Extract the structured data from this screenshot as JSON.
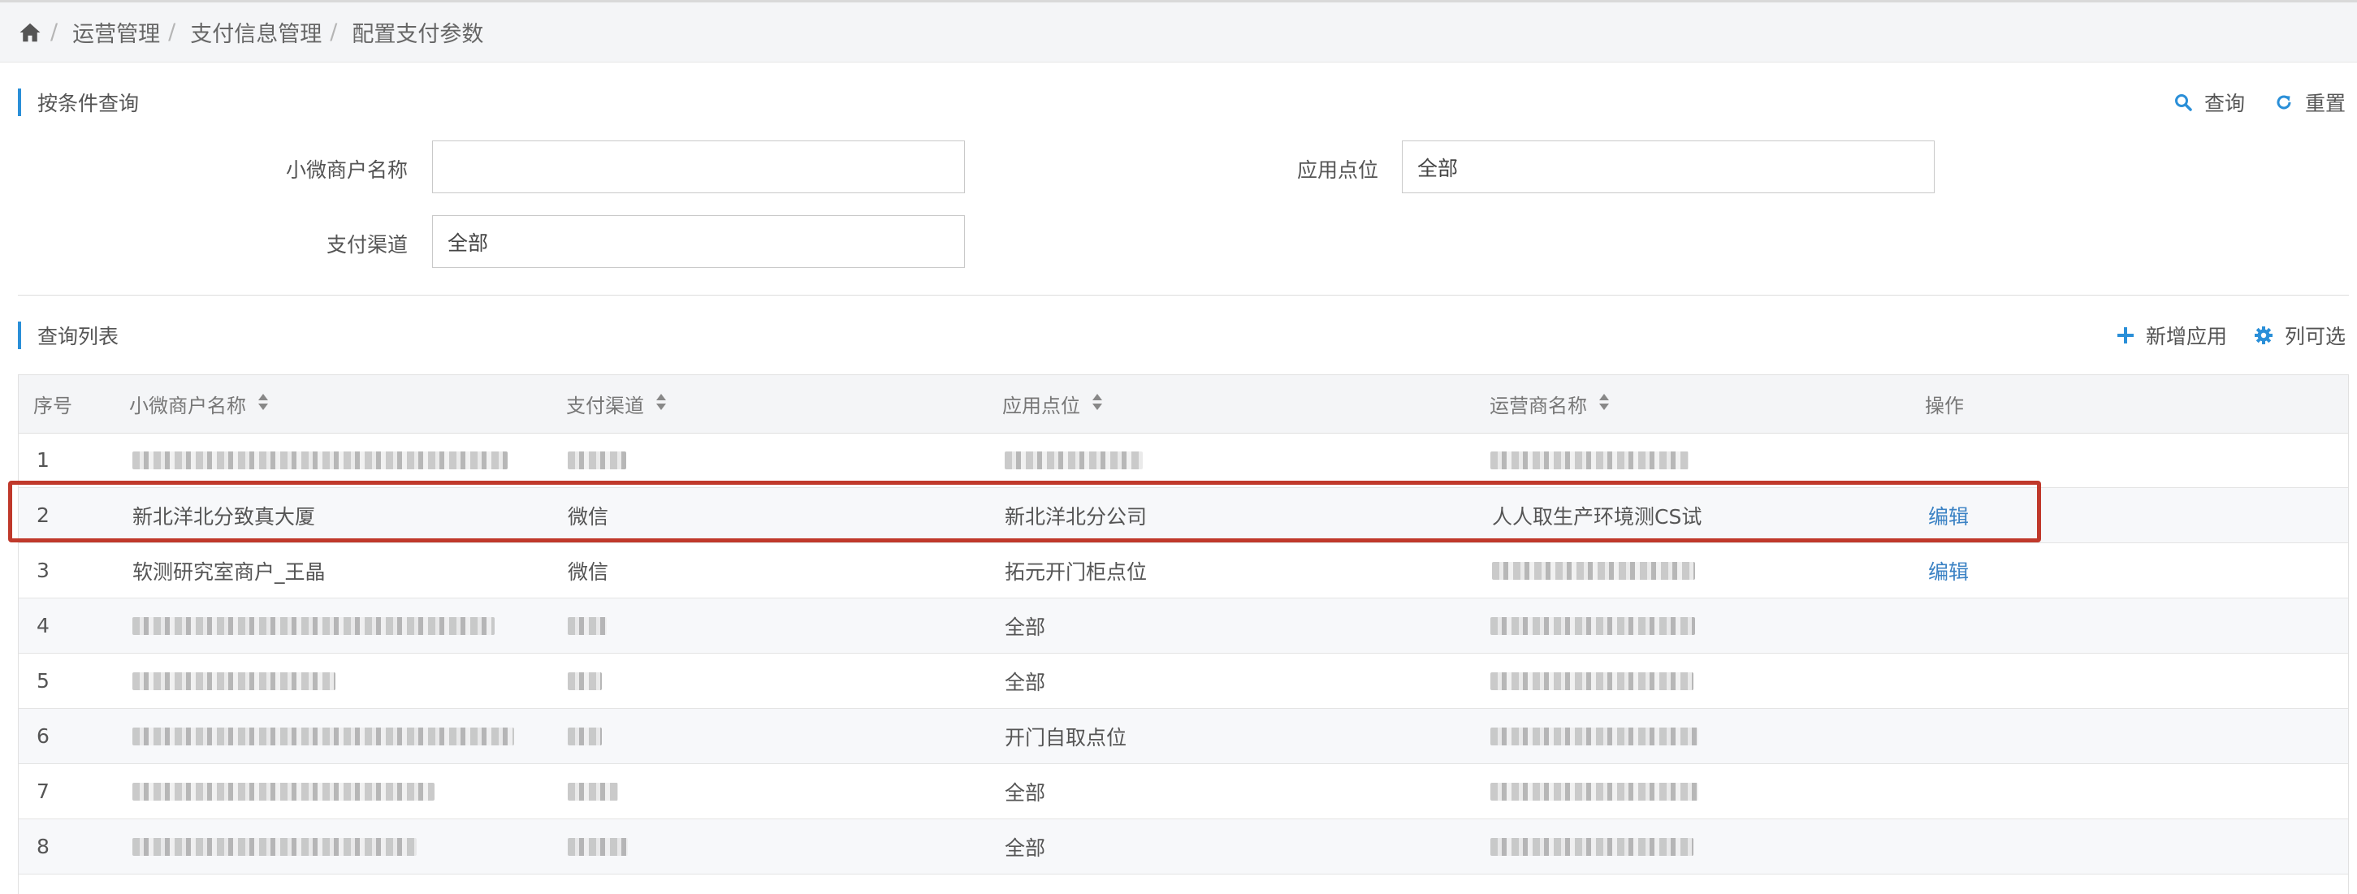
{
  "breadcrumb": {
    "items": [
      "运营管理",
      "支付信息管理",
      "配置支付参数"
    ],
    "separator": "/"
  },
  "query_section": {
    "title": "按条件查询",
    "search_label": "查询",
    "reset_label": "重置",
    "fields": {
      "merchant_name": {
        "label": "小微商户名称",
        "value": ""
      },
      "app_point": {
        "label": "应用点位",
        "value": "全部"
      },
      "pay_channel": {
        "label": "支付渠道",
        "value": "全部"
      }
    }
  },
  "list_section": {
    "title": "查询列表",
    "add_label": "新增应用",
    "columns_label": "列可选"
  },
  "table": {
    "headers": [
      "序号",
      "小微商户名称",
      "支付渠道",
      "应用点位",
      "运营商名称",
      "操作"
    ],
    "rows": [
      {
        "index": "1",
        "merchant": "",
        "channel": "",
        "point": "",
        "operator": "",
        "action": "",
        "blurred": [
          "merchant",
          "channel",
          "point",
          "operator"
        ]
      },
      {
        "index": "2",
        "merchant": "新北洋北分致真大厦",
        "channel": "微信",
        "point": "新北洋北分公司",
        "operator": "人人取生产环境测CS试",
        "action": "编辑",
        "blurred": []
      },
      {
        "index": "3",
        "merchant": "软测研究室商户_王晶",
        "channel": "微信",
        "point": "拓元开门柜点位",
        "operator": "",
        "action": "编辑",
        "blurred": [
          "operator"
        ]
      },
      {
        "index": "4",
        "merchant": "",
        "channel": "",
        "point": "全部",
        "operator": "",
        "action": "",
        "blurred": [
          "merchant",
          "channel",
          "operator"
        ]
      },
      {
        "index": "5",
        "merchant": "",
        "channel": "",
        "point": "全部",
        "operator": "",
        "action": "",
        "blurred": [
          "merchant",
          "channel",
          "operator"
        ]
      },
      {
        "index": "6",
        "merchant": "",
        "channel": "",
        "point": "开门自取点位",
        "operator": "",
        "action": "",
        "blurred": [
          "merchant",
          "channel",
          "operator"
        ]
      },
      {
        "index": "7",
        "merchant": "",
        "channel": "",
        "point": "全部",
        "operator": "",
        "action": "",
        "blurred": [
          "merchant",
          "channel",
          "operator"
        ]
      },
      {
        "index": "8",
        "merchant": "",
        "channel": "",
        "point": "全部",
        "operator": "",
        "action": "",
        "blurred": [
          "merchant",
          "channel",
          "operator"
        ]
      }
    ]
  },
  "colors": {
    "accent": "#2a8fd8",
    "link": "#3b82c4",
    "highlight_box": "#c0392b"
  },
  "icons": [
    "home-icon",
    "search-icon",
    "refresh-icon",
    "plus-icon",
    "gear-icon",
    "sort-icon"
  ]
}
